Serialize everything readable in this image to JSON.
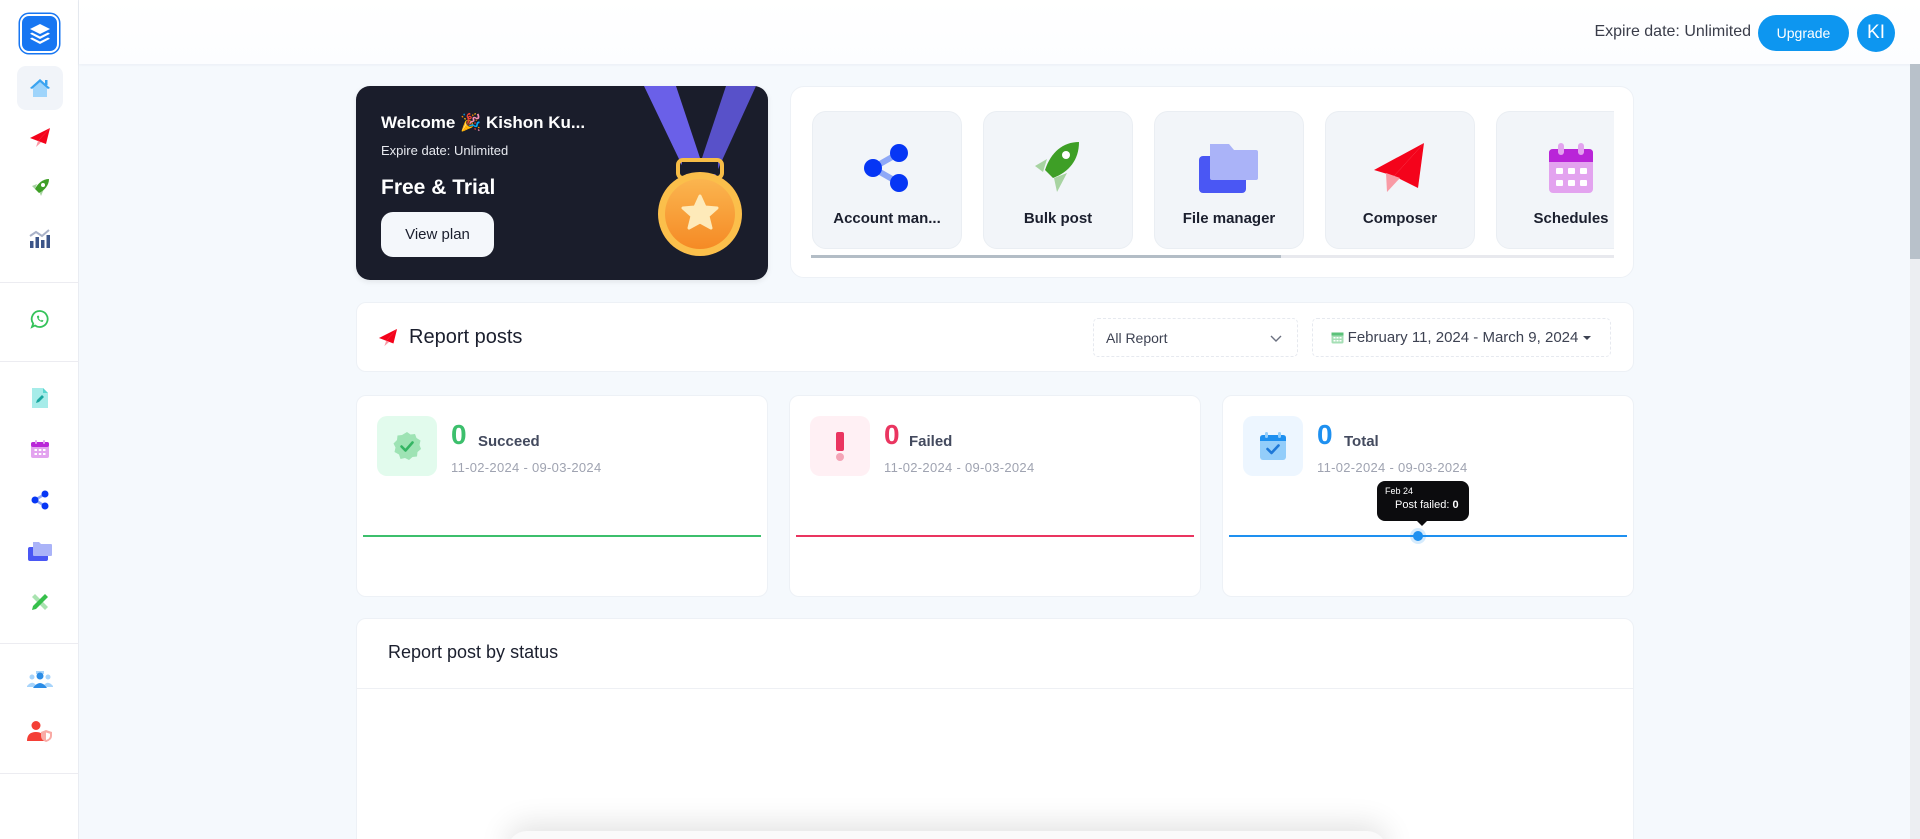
{
  "sidebar": {
    "logo_icon": "layers-logo-icon",
    "groups": [
      [
        {
          "name": "home",
          "icon": "home-icon",
          "active": true
        },
        {
          "name": "composer",
          "icon": "paper-plane-icon"
        },
        {
          "name": "bulk-post",
          "icon": "rocket-icon"
        },
        {
          "name": "analytics",
          "icon": "chart-icon"
        }
      ],
      [
        {
          "name": "whatsapp",
          "icon": "whatsapp-icon"
        }
      ],
      [
        {
          "name": "drafts",
          "icon": "edit-document-icon"
        },
        {
          "name": "schedules",
          "icon": "calendar-icon"
        },
        {
          "name": "account-manager",
          "icon": "share-icon"
        },
        {
          "name": "file-manager",
          "icon": "folder-icon"
        },
        {
          "name": "caption",
          "icon": "pencil-ruler-icon"
        }
      ],
      [
        {
          "name": "team",
          "icon": "users-icon"
        },
        {
          "name": "roles",
          "icon": "user-shield-icon"
        }
      ]
    ]
  },
  "header": {
    "expire_text": "Expire date: Unlimited",
    "upgrade_label": "Upgrade",
    "avatar_initials": "KI"
  },
  "welcome": {
    "title": "Welcome 🎉 Kishon Ku...",
    "expire_text": "Expire date: Unlimited",
    "plan": "Free & Trial",
    "view_plan_label": "View plan"
  },
  "shortcuts": {
    "items": [
      {
        "label": "Account man...",
        "icon": "share-icon"
      },
      {
        "label": "Bulk post",
        "icon": "rocket-icon"
      },
      {
        "label": "File manager",
        "icon": "folder-icon"
      },
      {
        "label": "Composer",
        "icon": "paper-plane-icon"
      },
      {
        "label": "Schedules",
        "icon": "calendar-icon"
      }
    ],
    "scroll_fraction": 0.585
  },
  "report": {
    "title": "Report posts",
    "filter_value": "All Report",
    "date_range": "February 11, 2024 - March 9, 2024"
  },
  "stats": [
    {
      "value": "0",
      "label": "Succeed",
      "range": "11-02-2024 - 09-03-2024",
      "color": "#3cbf6c",
      "icon": "badge-check-icon"
    },
    {
      "value": "0",
      "label": "Failed",
      "range": "11-02-2024 - 09-03-2024",
      "color": "#ea3560",
      "icon": "exclamation-icon"
    },
    {
      "value": "0",
      "label": "Total",
      "range": "11-02-2024 - 09-03-2024",
      "color": "#1e90f0",
      "icon": "calendar-check-icon"
    }
  ],
  "tooltip": {
    "date": "Feb 24",
    "label": "Post failed: ",
    "value": "0"
  },
  "status_section": {
    "title": "Report post by status"
  },
  "colors": {
    "accent": "#0d96f0",
    "success": "#3cbf6c",
    "danger": "#ea3560",
    "dark_card": "#1a1d2b"
  }
}
